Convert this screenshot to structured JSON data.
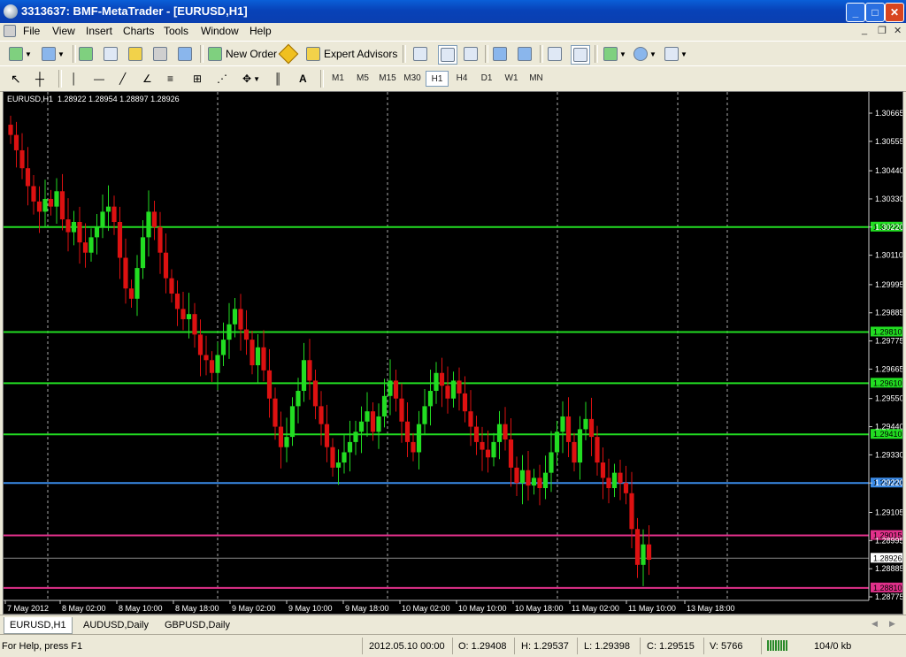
{
  "window": {
    "title": "3313637: BMF-MetaTrader - [EURUSD,H1]"
  },
  "menu": [
    "File",
    "View",
    "Insert",
    "Charts",
    "Tools",
    "Window",
    "Help"
  ],
  "toolbar": {
    "new_order": "New Order",
    "expert_advisors": "Expert Advisors"
  },
  "timeframes": [
    "M1",
    "M5",
    "M15",
    "M30",
    "H1",
    "H4",
    "D1",
    "W1",
    "MN"
  ],
  "active_timeframe": "H1",
  "chart": {
    "info": "EURUSD,H1  1.28922 1.28954 1.28897 1.28926",
    "price_ticks": [
      "1.30665",
      "1.30555",
      "1.30440",
      "1.30330",
      "1.30220",
      "1.30110",
      "1.29995",
      "1.29885",
      "1.29775",
      "1.29665",
      "1.29550",
      "1.29440",
      "1.29330",
      "1.29220",
      "1.29105",
      "1.28995",
      "1.28885",
      "1.28775"
    ],
    "time_labels": [
      "7 May 2012",
      "8 May 02:00",
      "8 May 10:00",
      "8 May 18:00",
      "9 May 02:00",
      "9 May 10:00",
      "9 May 18:00",
      "10 May 02:00",
      "10 May 10:00",
      "10 May 18:00",
      "11 May 02:00",
      "11 May 10:00",
      "13 May 18:00"
    ],
    "levels": [
      {
        "price": "1.30220",
        "color": "#22dd22"
      },
      {
        "price": "1.29810",
        "color": "#22dd22"
      },
      {
        "price": "1.29610",
        "color": "#22dd22"
      },
      {
        "price": "1.29410",
        "color": "#22dd22"
      },
      {
        "price": "1.29220",
        "color": "#3a8be8"
      },
      {
        "price": "1.29015",
        "color": "#e0308a"
      },
      {
        "price": "1.28810",
        "color": "#e0308a"
      }
    ],
    "current_price": "1.28926",
    "bull_color": "#22dd22",
    "bear_color": "#dd1111"
  },
  "tabs": [
    "EURUSD,H1",
    "AUDUSD,Daily",
    "GBPUSD,Daily"
  ],
  "status": {
    "help": "For Help, press F1",
    "time": "2012.05.10 00:00",
    "open": "O: 1.29408",
    "high": "H: 1.29537",
    "low": "L: 1.29398",
    "close": "C: 1.29515",
    "volume": "V: 5766",
    "traffic": "104/0 kb"
  }
}
